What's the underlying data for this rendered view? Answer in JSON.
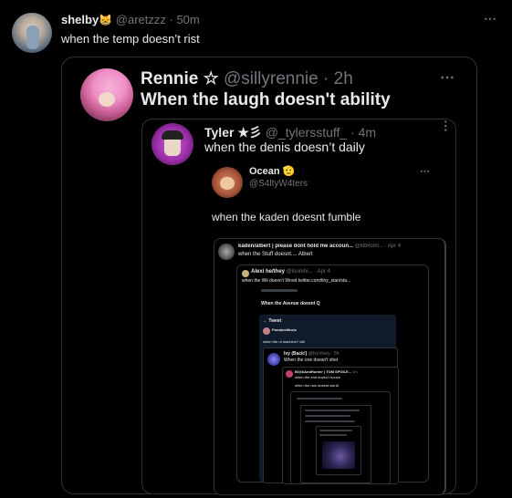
{
  "post": {
    "author_name": "shelby",
    "emoji": "😸",
    "handle": "@aretzzz",
    "time": "· 50m",
    "text": "when the temp doesn’t rist"
  },
  "quote1": {
    "author_name": "Rennie ☆",
    "handle": "@sillyrennie",
    "time": "· 2h",
    "text": "When the laugh doesn't ability"
  },
  "quote2": {
    "author_name": "Tyler ★彡",
    "handle": "@_tylersstuff_",
    "time": "· 4m",
    "text": "when the denis doesn’t daily"
  },
  "quote3": {
    "author_name": "Ocean",
    "emoji": "🫡",
    "handle": "@S4ltyW4ters",
    "text": "when the kaden doesnt fumble"
  },
  "quote4": {
    "author_name": "kaden/albert | please dont hold me accoun...",
    "handle": "@littRoml...",
    "time": "· Apr 4",
    "text": "when the Stuff doesnt.... Albert"
  },
  "quote5": {
    "author_name": "Alexi he/they",
    "handle": "@loomhi...",
    "time": "· Apr 4",
    "text": "when the Wii doesn't Wood  twitter.com/tiny_stan/sta..."
  },
  "quote6": {
    "title": "When the Avenue doesnt Q"
  },
  "quote7": {
    "header": "Tweet",
    "author_name": "ParadoxMusic",
    "text": "when the ut machine? will"
  },
  "quote8": {
    "author_name": "Ivy (Back!)",
    "handle": "@IvyViney · 5h",
    "text": "When the one doesn't shet"
  },
  "quote9": {
    "author_name": "Bl@kAndHunter | TOM SPOILE...",
    "handle": "5m",
    "text": "when the end doesn't house",
    "subtext": "when the rain doesnt world"
  },
  "icons": {
    "more": "more-icon"
  }
}
